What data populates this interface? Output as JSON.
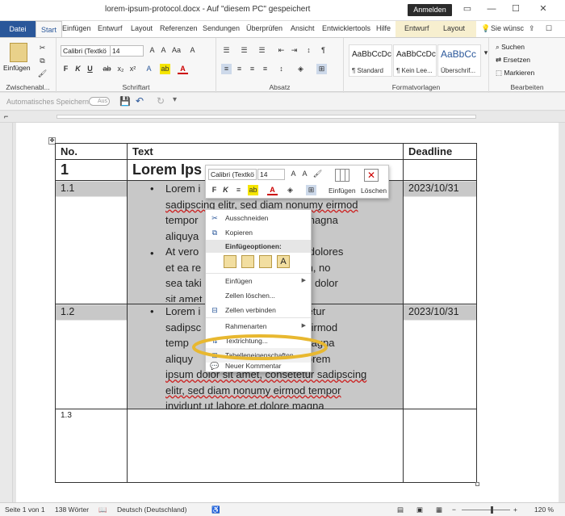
{
  "title_bar": {
    "title": "lorem-ipsum-protocol.docx  -  Auf \"diesem PC\" gespeichert",
    "signin_label": "Anmelden"
  },
  "ribbon_tabs": [
    {
      "label": "Datei"
    },
    {
      "label": "Start"
    },
    {
      "label": "Einfügen"
    },
    {
      "label": "Entwurf"
    },
    {
      "label": "Layout"
    },
    {
      "label": "Referenzen"
    },
    {
      "label": "Sendungen"
    },
    {
      "label": "Überprüfen"
    },
    {
      "label": "Ansicht"
    },
    {
      "label": "Entwicklertools"
    },
    {
      "label": "Hilfe"
    },
    {
      "label": "Entwurf"
    },
    {
      "label": "Layout"
    },
    {
      "label": "Sie wünsc"
    }
  ],
  "ribbon": {
    "clipboard": {
      "paste_label": "Einfügen",
      "group_label": "Zwischenabl..."
    },
    "font": {
      "font_name": "Calibri (Textkö",
      "font_size": "14",
      "group_label": "Schriftart"
    },
    "paragraph": {
      "group_label": "Absatz"
    },
    "styles": {
      "items": [
        {
          "preview": "AaBbCcDc",
          "name": "¶ Standard"
        },
        {
          "preview": "AaBbCcDc",
          "name": "¶ Kein Lee..."
        },
        {
          "preview": "AaBbCc",
          "name": "Überschrif..."
        }
      ],
      "group_label": "Formatvorlagen"
    },
    "editing": {
      "search": "Suchen",
      "replace": "Ersetzen",
      "select": "Markieren",
      "group_label": "Bearbeiten"
    }
  },
  "quick_access": {
    "autosave_label": "Automatisches Speichern",
    "autosave_state": "Aus"
  },
  "table": {
    "headers": [
      "No.",
      "Text",
      "Deadline"
    ],
    "title_row": {
      "number": "1",
      "text": "Lorem Ips"
    },
    "rows": [
      {
        "number": "1.1",
        "deadline": "2023/10/31",
        "lines": [
          "Lorem i",
          "sadipscing elitr, sed diam nonumy eirmod",
          "tempor                        t dolore magna",
          "aliquya                          uptua.",
          "At vero                       usto duo dolores",
          "et ea re                      gubergren, no",
          "sea taki                     rem ipsum dolor",
          "sit amet                      sit amet"
        ]
      },
      {
        "number": "1.2",
        "deadline": "2023/10/31",
        "lines": [
          "Lorem i                          consetetur",
          "sadipsc                          numy eirmod",
          "temp                              olore magna",
          "aliquy                          uptua. Lorem",
          "ipsum dolor sit amet, consetetur sadipscing",
          "elitr, sed diam nonumy eirmod tempor",
          "invidunt ut labore et dolore magna"
        ]
      },
      {
        "number": "1.3",
        "deadline": "",
        "lines": []
      }
    ]
  },
  "mini_toolbar": {
    "font_name": "Calibri (Textkö",
    "font_size": "14",
    "insert_label": "Einfügen",
    "delete_label": "Löschen"
  },
  "context_menu": {
    "items_top": [
      {
        "label": "Ausschneiden",
        "icon": "scissors-icon"
      },
      {
        "label": "Kopieren",
        "icon": "copy-icon"
      }
    ],
    "paste_header": "Einfügeoptionen:",
    "items_bottom": [
      {
        "label": "Einfügen",
        "icon": "",
        "submenu": true
      },
      {
        "label": "Zellen löschen...",
        "icon": "",
        "submenu": false
      },
      {
        "label": "Zellen verbinden",
        "icon": "merge-cells-icon",
        "submenu": false
      },
      {
        "label": "Rahmenarten",
        "icon": "",
        "submenu": true
      },
      {
        "label": "Textrichtung...",
        "icon": "text-direction-icon",
        "submenu": false
      },
      {
        "label": "Tabelleneigenschaften...",
        "icon": "table-properties-icon",
        "submenu": false,
        "highlighted": true
      },
      {
        "label": "Neuer Kommentar",
        "icon": "comment-icon",
        "submenu": false
      }
    ]
  },
  "status_bar": {
    "page": "Seite 1 von 1",
    "words": "138 Wörter",
    "language": "Deutsch (Deutschland)",
    "zoom": "120 %"
  },
  "colors": {
    "accent": "#2a579a",
    "highlight_ellipse": "#e8b830",
    "cell_shading": "#c8c8c8"
  }
}
